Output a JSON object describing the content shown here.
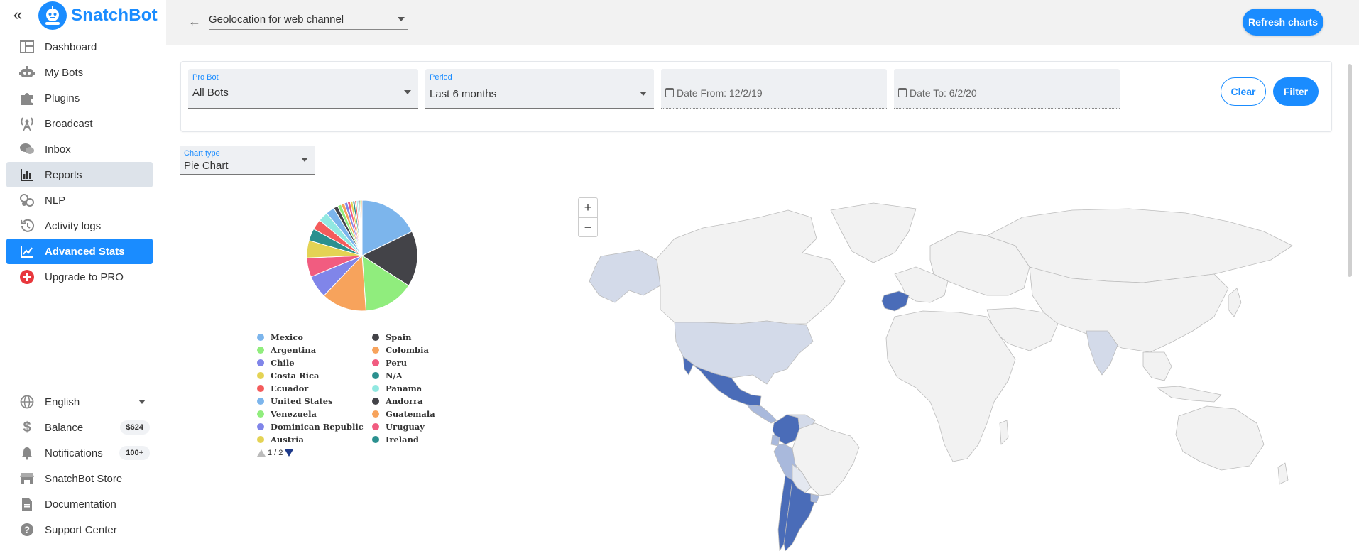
{
  "app": {
    "name": "SnatchBot",
    "brand_color": "#1a8cff"
  },
  "sidebar": {
    "items": [
      {
        "label": "Dashboard",
        "icon": "dashboard-icon"
      },
      {
        "label": "My Bots",
        "icon": "robot-icon"
      },
      {
        "label": "Plugins",
        "icon": "puzzle-icon"
      },
      {
        "label": "Broadcast",
        "icon": "broadcast-icon"
      },
      {
        "label": "Inbox",
        "icon": "chat-icon"
      },
      {
        "label": "Reports",
        "icon": "bar-chart-icon"
      },
      {
        "label": "NLP",
        "icon": "nlp-icon"
      },
      {
        "label": "Activity logs",
        "icon": "history-icon"
      },
      {
        "label": "Advanced Stats",
        "icon": "trend-chart-icon"
      },
      {
        "label": "Upgrade to PRO",
        "icon": "plus-circle-icon"
      }
    ],
    "bottom": {
      "language": "English",
      "balance_label": "Balance",
      "balance_value": "$624",
      "notifications_label": "Notifications",
      "notifications_count": "100+",
      "store": "SnatchBot Store",
      "documentation": "Documentation",
      "support": "Support Center"
    }
  },
  "header": {
    "report": "Geolocation for web channel",
    "refresh": "Refresh charts"
  },
  "filters": {
    "pro_bot_label": "Pro Bot",
    "pro_bot_value": "All Bots",
    "period_label": "Period",
    "period_value": "Last 6 months",
    "date_from": "Date From: 12/2/19",
    "date_to": "Date To: 6/2/20",
    "clear": "Clear",
    "filter": "Filter"
  },
  "chart_type": {
    "label": "Chart type",
    "value": "Pie Chart"
  },
  "pager": {
    "text": "1 / 2"
  },
  "zoom": {
    "in": "+",
    "out": "−"
  },
  "chart_data": {
    "type": "pie",
    "legend": [
      {
        "name": "Mexico",
        "color": "#7cb5ec"
      },
      {
        "name": "Spain",
        "color": "#434348"
      },
      {
        "name": "Argentina",
        "color": "#90ed7d"
      },
      {
        "name": "Colombia",
        "color": "#f7a35c"
      },
      {
        "name": "Chile",
        "color": "#8085e9"
      },
      {
        "name": "Peru",
        "color": "#f15c80"
      },
      {
        "name": "Costa Rica",
        "color": "#e4d354"
      },
      {
        "name": "N/A",
        "color": "#2b908f"
      },
      {
        "name": "Ecuador",
        "color": "#f45b5b"
      },
      {
        "name": "Panama",
        "color": "#91e8e1"
      },
      {
        "name": "United States",
        "color": "#7cb5ec"
      },
      {
        "name": "Andorra",
        "color": "#434348"
      },
      {
        "name": "Venezuela",
        "color": "#90ed7d"
      },
      {
        "name": "Guatemala",
        "color": "#f7a35c"
      },
      {
        "name": "Dominican Republic",
        "color": "#8085e9"
      },
      {
        "name": "Uruguay",
        "color": "#f15c80"
      },
      {
        "name": "Austria",
        "color": "#e4d354"
      },
      {
        "name": "Ireland",
        "color": "#2b908f"
      }
    ],
    "slices": [
      {
        "color": "#7cb5ec",
        "value": 17.5
      },
      {
        "color": "#434348",
        "value": 16
      },
      {
        "color": "#90ed7d",
        "value": 14.5
      },
      {
        "color": "#f7a35c",
        "value": 13
      },
      {
        "color": "#8085e9",
        "value": 6.5
      },
      {
        "color": "#f15c80",
        "value": 5.5
      },
      {
        "color": "#e4d354",
        "value": 5
      },
      {
        "color": "#2b908f",
        "value": 3.5
      },
      {
        "color": "#f45b5b",
        "value": 3
      },
      {
        "color": "#91e8e1",
        "value": 2.8
      },
      {
        "color": "#7cb5ec",
        "value": 2.5
      },
      {
        "color": "#434348",
        "value": 1.2
      },
      {
        "color": "#90ed7d",
        "value": 1.1
      },
      {
        "color": "#f7a35c",
        "value": 1
      },
      {
        "color": "#8085e9",
        "value": 0.9
      },
      {
        "color": "#f15c80",
        "value": 0.8
      },
      {
        "color": "#e4d354",
        "value": 0.7
      },
      {
        "color": "#2b908f",
        "value": 0.6
      },
      {
        "color": "#f45b5b",
        "value": 0.5
      },
      {
        "color": "#91e8e1",
        "value": 0.4
      },
      {
        "color": "#7cb5ec",
        "value": 0.3
      },
      {
        "color": "#434348",
        "value": 0.3
      },
      {
        "color": "#90ed7d",
        "value": 0.3
      },
      {
        "color": "#f7a35c",
        "value": 0.3
      }
    ]
  },
  "map_colors": {
    "base": "#f2f2f2",
    "light": "#d3dae9",
    "medium": "#a9b9dc",
    "dark": "#4a6cb8",
    "border": "#bcbcbc"
  }
}
